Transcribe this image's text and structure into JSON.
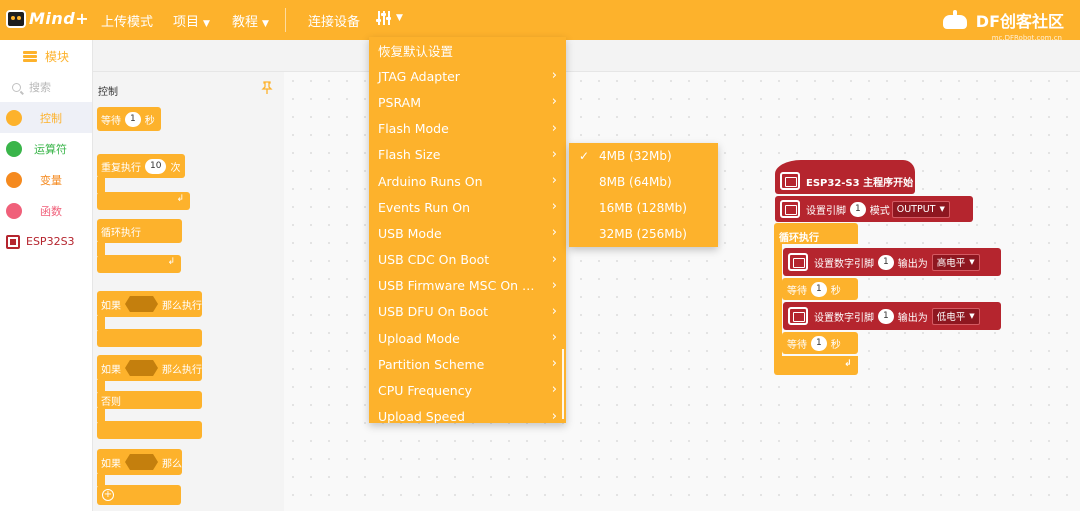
{
  "app": {
    "logo_text": "Mind+",
    "brand_text": "DF创客社区",
    "brand_subtext": "mc.DFRobot.com.cn"
  },
  "topnav": {
    "upload_mode": "上传模式",
    "project": "项目",
    "tutorial": "教程",
    "connect_device": "连接设备"
  },
  "tabs": {
    "blocks": "模块"
  },
  "sidebar": {
    "search_placeholder": "搜索",
    "categories": [
      {
        "label": "控制",
        "color": "#fdb22c",
        "active": true
      },
      {
        "label": "运算符",
        "color": "#3ab54a"
      },
      {
        "label": "变量",
        "color": "#f58a1f"
      },
      {
        "label": "函数",
        "color": "#f0607a"
      },
      {
        "label": "ESP32S3",
        "color": "#b5252e"
      }
    ]
  },
  "palette": {
    "title": "控制",
    "wait": {
      "prefix": "等待",
      "value": "1",
      "suffix": "秒"
    },
    "repeat": {
      "prefix": "重复执行",
      "value": "10",
      "suffix": "次"
    },
    "forever": "循环执行",
    "if_then": {
      "prefix": "如果",
      "suffix": "那么执行"
    },
    "if_else": {
      "prefix": "如果",
      "suffix": "那么执行",
      "else": "否则"
    },
    "if_then_plus": {
      "prefix": "如果",
      "suffix": "那么"
    }
  },
  "settings_menu": {
    "items": [
      {
        "label": "恢复默认设置",
        "submenu": false
      },
      {
        "label": "JTAG Adapter",
        "submenu": true
      },
      {
        "label": "PSRAM",
        "submenu": true
      },
      {
        "label": "Flash Mode",
        "submenu": true
      },
      {
        "label": "Flash Size",
        "submenu": true
      },
      {
        "label": "Arduino Runs On",
        "submenu": true
      },
      {
        "label": "Events Run On",
        "submenu": true
      },
      {
        "label": "USB Mode",
        "submenu": true
      },
      {
        "label": "USB CDC On Boot",
        "submenu": true
      },
      {
        "label": "USB Firmware MSC On …",
        "submenu": true
      },
      {
        "label": "USB DFU On Boot",
        "submenu": true
      },
      {
        "label": "Upload Mode",
        "submenu": true
      },
      {
        "label": "Partition Scheme",
        "submenu": true
      },
      {
        "label": "CPU Frequency",
        "submenu": true
      },
      {
        "label": "Upload Speed",
        "submenu": true
      }
    ]
  },
  "flash_size_submenu": {
    "items": [
      {
        "label": "4MB (32Mb)",
        "checked": true
      },
      {
        "label": "8MB (64Mb)",
        "checked": false
      },
      {
        "label": "16MB (128Mb)",
        "checked": false
      },
      {
        "label": "32MB (256Mb)",
        "checked": false
      }
    ]
  },
  "program": {
    "hat": "ESP32-S3 主程序开始",
    "pin_mode": {
      "prefix": "设置引脚",
      "pin": "1",
      "mid": "模式",
      "mode": "OUTPUT"
    },
    "loop": "循环执行",
    "write_high": {
      "prefix": "设置数字引脚",
      "pin": "1",
      "mid": "输出为",
      "level": "高电平"
    },
    "wait1": {
      "prefix": "等待",
      "value": "1",
      "suffix": "秒"
    },
    "write_low": {
      "prefix": "设置数字引脚",
      "pin": "1",
      "mid": "输出为",
      "level": "低电平"
    },
    "wait2": {
      "prefix": "等待",
      "value": "1",
      "suffix": "秒"
    }
  }
}
